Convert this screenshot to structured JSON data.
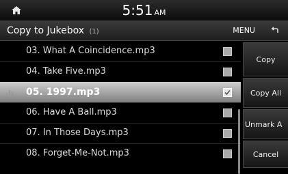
{
  "status": {
    "time": "5:51",
    "ampm": "AM"
  },
  "header": {
    "title": "Copy to Jukebox",
    "count": "(1)",
    "menu_label": "MENU"
  },
  "list": {
    "items": [
      {
        "label": "03. What A Coincidence.mp3",
        "checked": false,
        "playing": false
      },
      {
        "label": "04. Take Five.mp3",
        "checked": false,
        "playing": false
      },
      {
        "label": "05. 1997.mp3",
        "checked": true,
        "playing": true
      },
      {
        "label": "06. Have A Ball.mp3",
        "checked": false,
        "playing": false
      },
      {
        "label": "07. In Those Days.mp3",
        "checked": false,
        "playing": false
      },
      {
        "label": "08. Forget-Me-Not.mp3",
        "checked": false,
        "playing": false
      }
    ]
  },
  "side": {
    "copy": "Copy",
    "copy_all": "Copy All",
    "unmark_all": "Unmark A",
    "cancel": "Cancel"
  },
  "icons": {
    "home": "home-icon",
    "back": "back-arrow-icon",
    "playing": "equalizer-icon",
    "check": "checkmark-icon"
  }
}
